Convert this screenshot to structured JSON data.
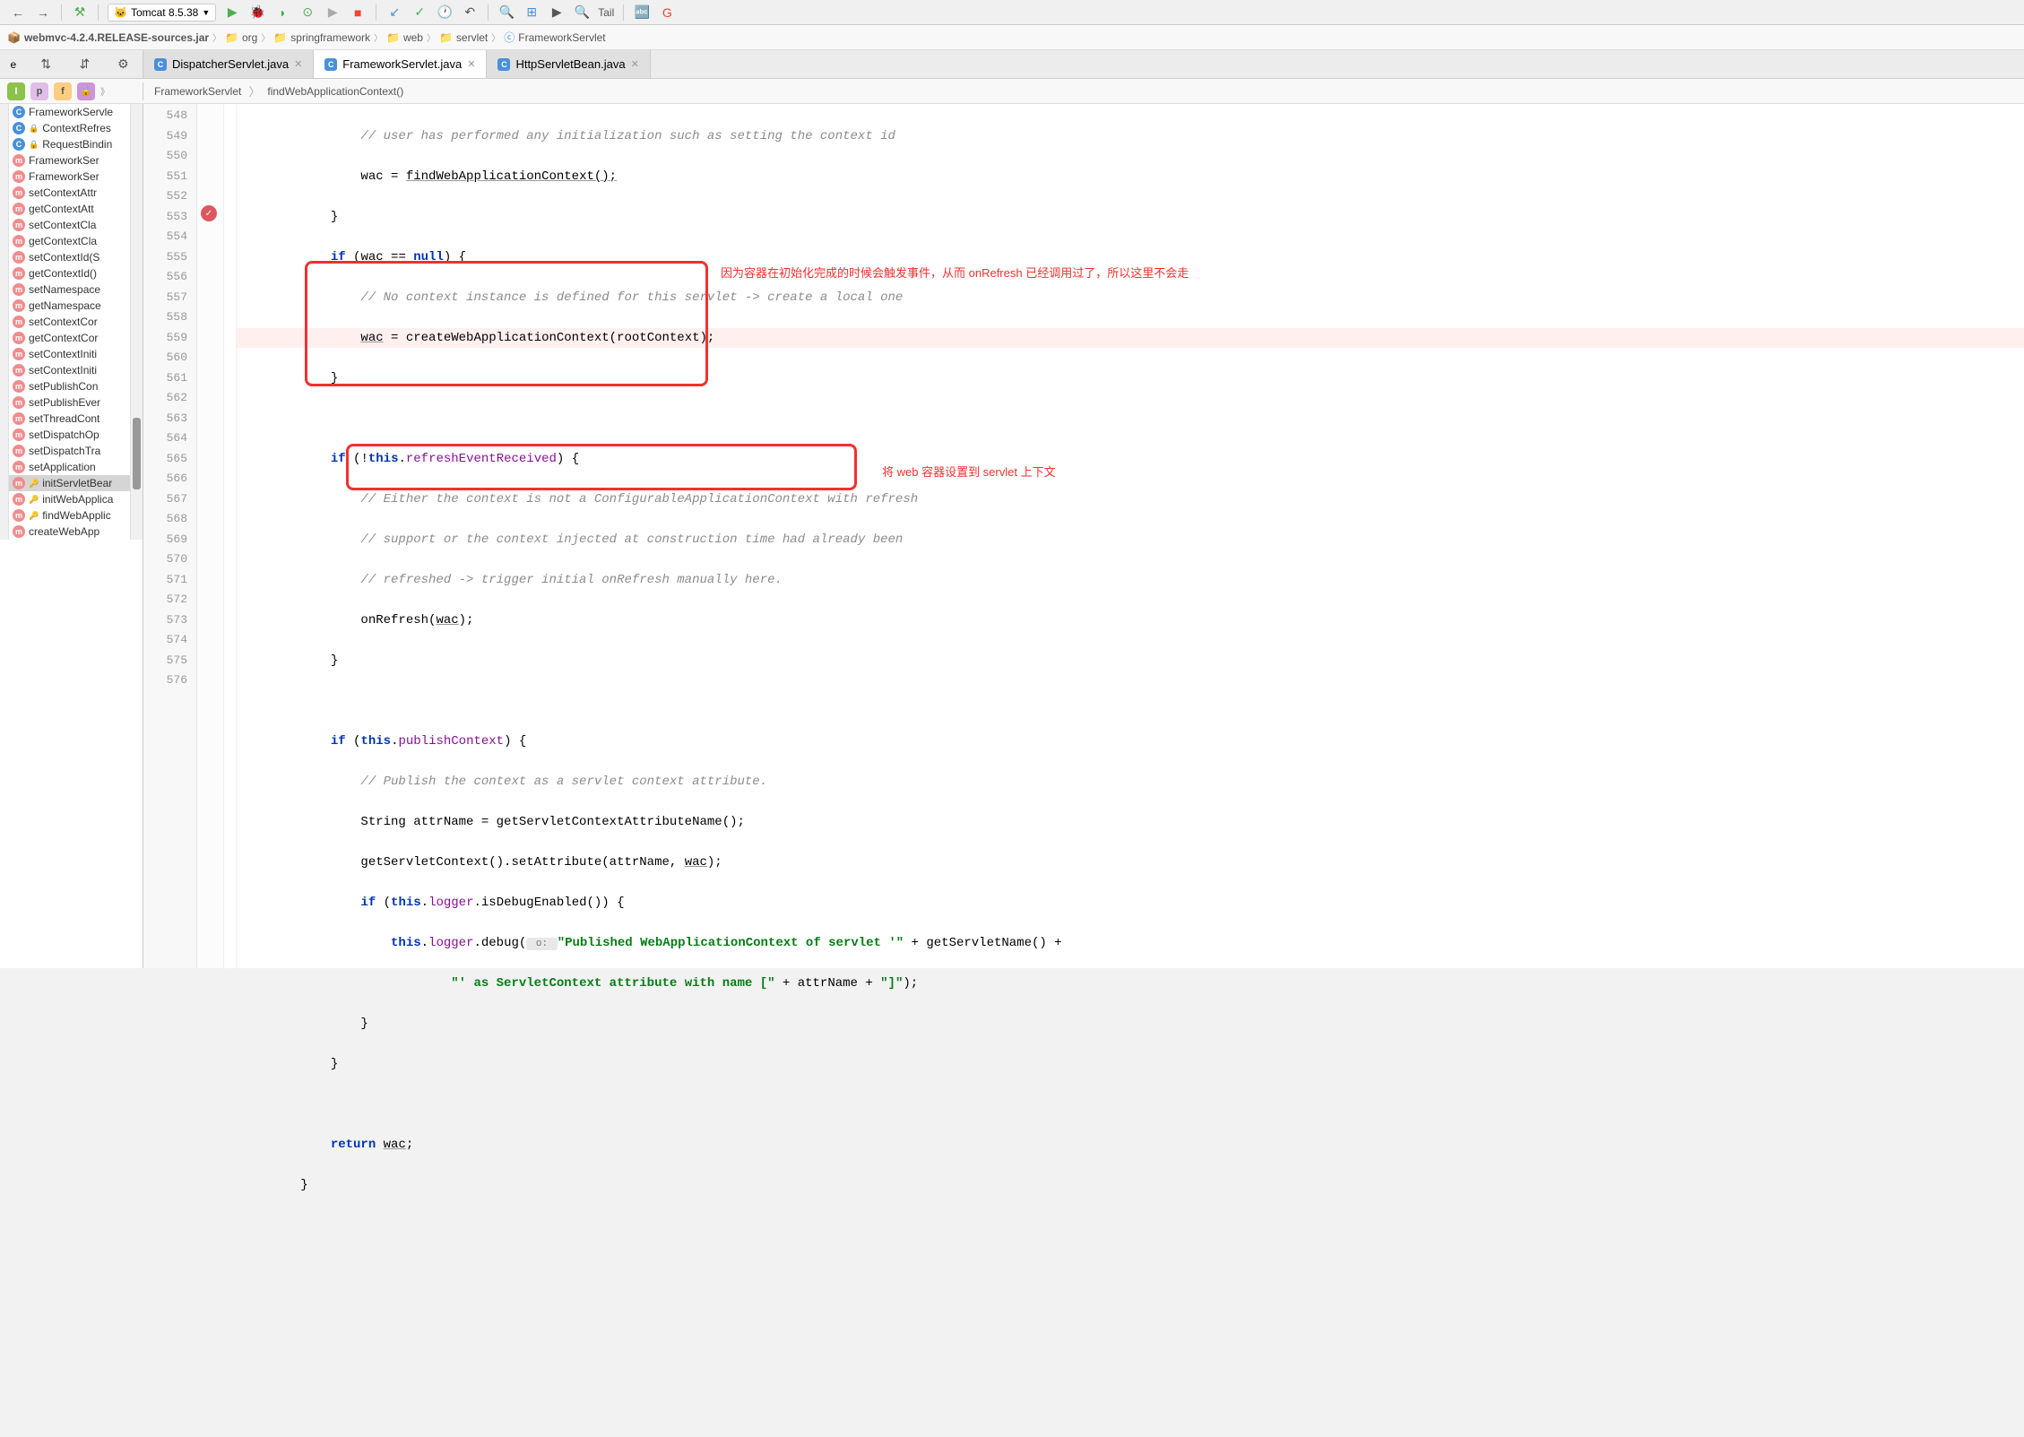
{
  "toolbar": {
    "runConfig": "Tomcat 8.5.38",
    "tail": "Tail"
  },
  "breadcrumb": [
    {
      "icon": "jar",
      "label": "webmvc-4.2.4.RELEASE-sources.jar"
    },
    {
      "icon": "folder",
      "label": "org"
    },
    {
      "icon": "folder",
      "label": "springframework"
    },
    {
      "icon": "folder",
      "label": "web"
    },
    {
      "icon": "folder",
      "label": "servlet"
    },
    {
      "icon": "class",
      "label": "FrameworkServlet"
    }
  ],
  "tabs": [
    {
      "label": "DispatcherServlet.java",
      "active": false
    },
    {
      "label": "FrameworkServlet.java",
      "active": true
    },
    {
      "label": "HttpServletBean.java",
      "active": false
    }
  ],
  "context": {
    "class": "FrameworkServlet",
    "method": "findWebApplicationContext()"
  },
  "structure": [
    {
      "icon": "c",
      "label": "FrameworkServle"
    },
    {
      "icon": "c",
      "label": "ContextRefres",
      "lock": true
    },
    {
      "icon": "c",
      "label": "RequestBindin",
      "lock": true
    },
    {
      "icon": "m",
      "label": "FrameworkSer"
    },
    {
      "icon": "m",
      "label": "FrameworkSer"
    },
    {
      "icon": "m",
      "label": "setContextAttr"
    },
    {
      "icon": "m",
      "label": "getContextAtt"
    },
    {
      "icon": "m",
      "label": "setContextCla"
    },
    {
      "icon": "m",
      "label": "getContextCla"
    },
    {
      "icon": "m",
      "label": "setContextId(S"
    },
    {
      "icon": "m",
      "label": "getContextId()"
    },
    {
      "icon": "m",
      "label": "setNamespace"
    },
    {
      "icon": "m",
      "label": "getNamespace"
    },
    {
      "icon": "m",
      "label": "setContextCor"
    },
    {
      "icon": "m",
      "label": "getContextCor"
    },
    {
      "icon": "m",
      "label": "setContextIniti"
    },
    {
      "icon": "m",
      "label": "setContextIniti"
    },
    {
      "icon": "m",
      "label": "setPublishCon"
    },
    {
      "icon": "m",
      "label": "setPublishEver"
    },
    {
      "icon": "m",
      "label": "setThreadCont"
    },
    {
      "icon": "m",
      "label": "setDispatchOp"
    },
    {
      "icon": "m",
      "label": "setDispatchTra"
    },
    {
      "icon": "m",
      "label": "setApplication"
    },
    {
      "icon": "m",
      "label": "initServletBear",
      "selected": true,
      "key": true
    },
    {
      "icon": "m",
      "label": "initWebApplica",
      "key": true
    },
    {
      "icon": "m",
      "label": "findWebApplic",
      "key": true
    },
    {
      "icon": "m",
      "label": "createWebApp"
    }
  ],
  "lineStart": 548,
  "lineCount": 29,
  "breakpointLine": 553,
  "code": {
    "l548": "// user has performed any initialization such as setting the context id",
    "l549a": "wac = ",
    "l549b": "findWebApplicationContext();",
    "l551_kw": "if",
    "l551_a": " (wac == ",
    "l551_null": "null",
    "l551_b": ") {",
    "l552": "// No context instance is defined for this servlet -> create a local one",
    "l553a": "wac",
    "l553b": " = createWebApplicationContext(rootContext);",
    "l556_kw": "if",
    "l556_a": " (!",
    "l556_this": "this",
    "l556_b": ".",
    "l556_field": "refreshEventReceived",
    "l556_c": ") {",
    "l557": "// Either the context is not a ConfigurableApplicationContext with refresh",
    "l558": "// support or the context injected at construction time had already been",
    "l559": "// refreshed -> trigger initial onRefresh manually here.",
    "l560a": "onRefresh(",
    "l560b": "wac",
    "l560c": ");",
    "l563_kw": "if",
    "l563_a": " (",
    "l563_this": "this",
    "l563_b": ".",
    "l563_field": "publishContext",
    "l563_c": ") {",
    "l564": "// Publish the context as a servlet context attribute.",
    "l565": "String attrName = getServletContextAttributeName();",
    "l566a": "getServletContext().setAttribute(attrName, ",
    "l566b": "wac",
    "l566c": ");",
    "l567_kw": "if",
    "l567_a": " (",
    "l567_this": "this",
    "l567_b": ".",
    "l567_field": "logger",
    "l567_c": ".isDebugEnabled()) {",
    "l568_this": "this",
    "l568_a": ".",
    "l568_field": "logger",
    "l568_b": ".debug(",
    "l568_hint": " o: ",
    "l568_str": "\"Published WebApplicationContext of servlet '\"",
    "l568_c": " + getServletName() +",
    "l569_str": "\"' as ServletContext attribute with name [\"",
    "l569_a": " + attrName + ",
    "l569_str2": "\"]\"",
    "l569_b": ");",
    "l573_kw": "return",
    "l573_a": " ",
    "l573_b": "wac",
    "l573_c": ";"
  },
  "annotations": {
    "a1": "因为容器在初始化完成的时候会触发事件，从而 onRefresh 已经调用过了，所以这里不会走",
    "a2": "将 web 容器设置到 servlet 上下文"
  }
}
